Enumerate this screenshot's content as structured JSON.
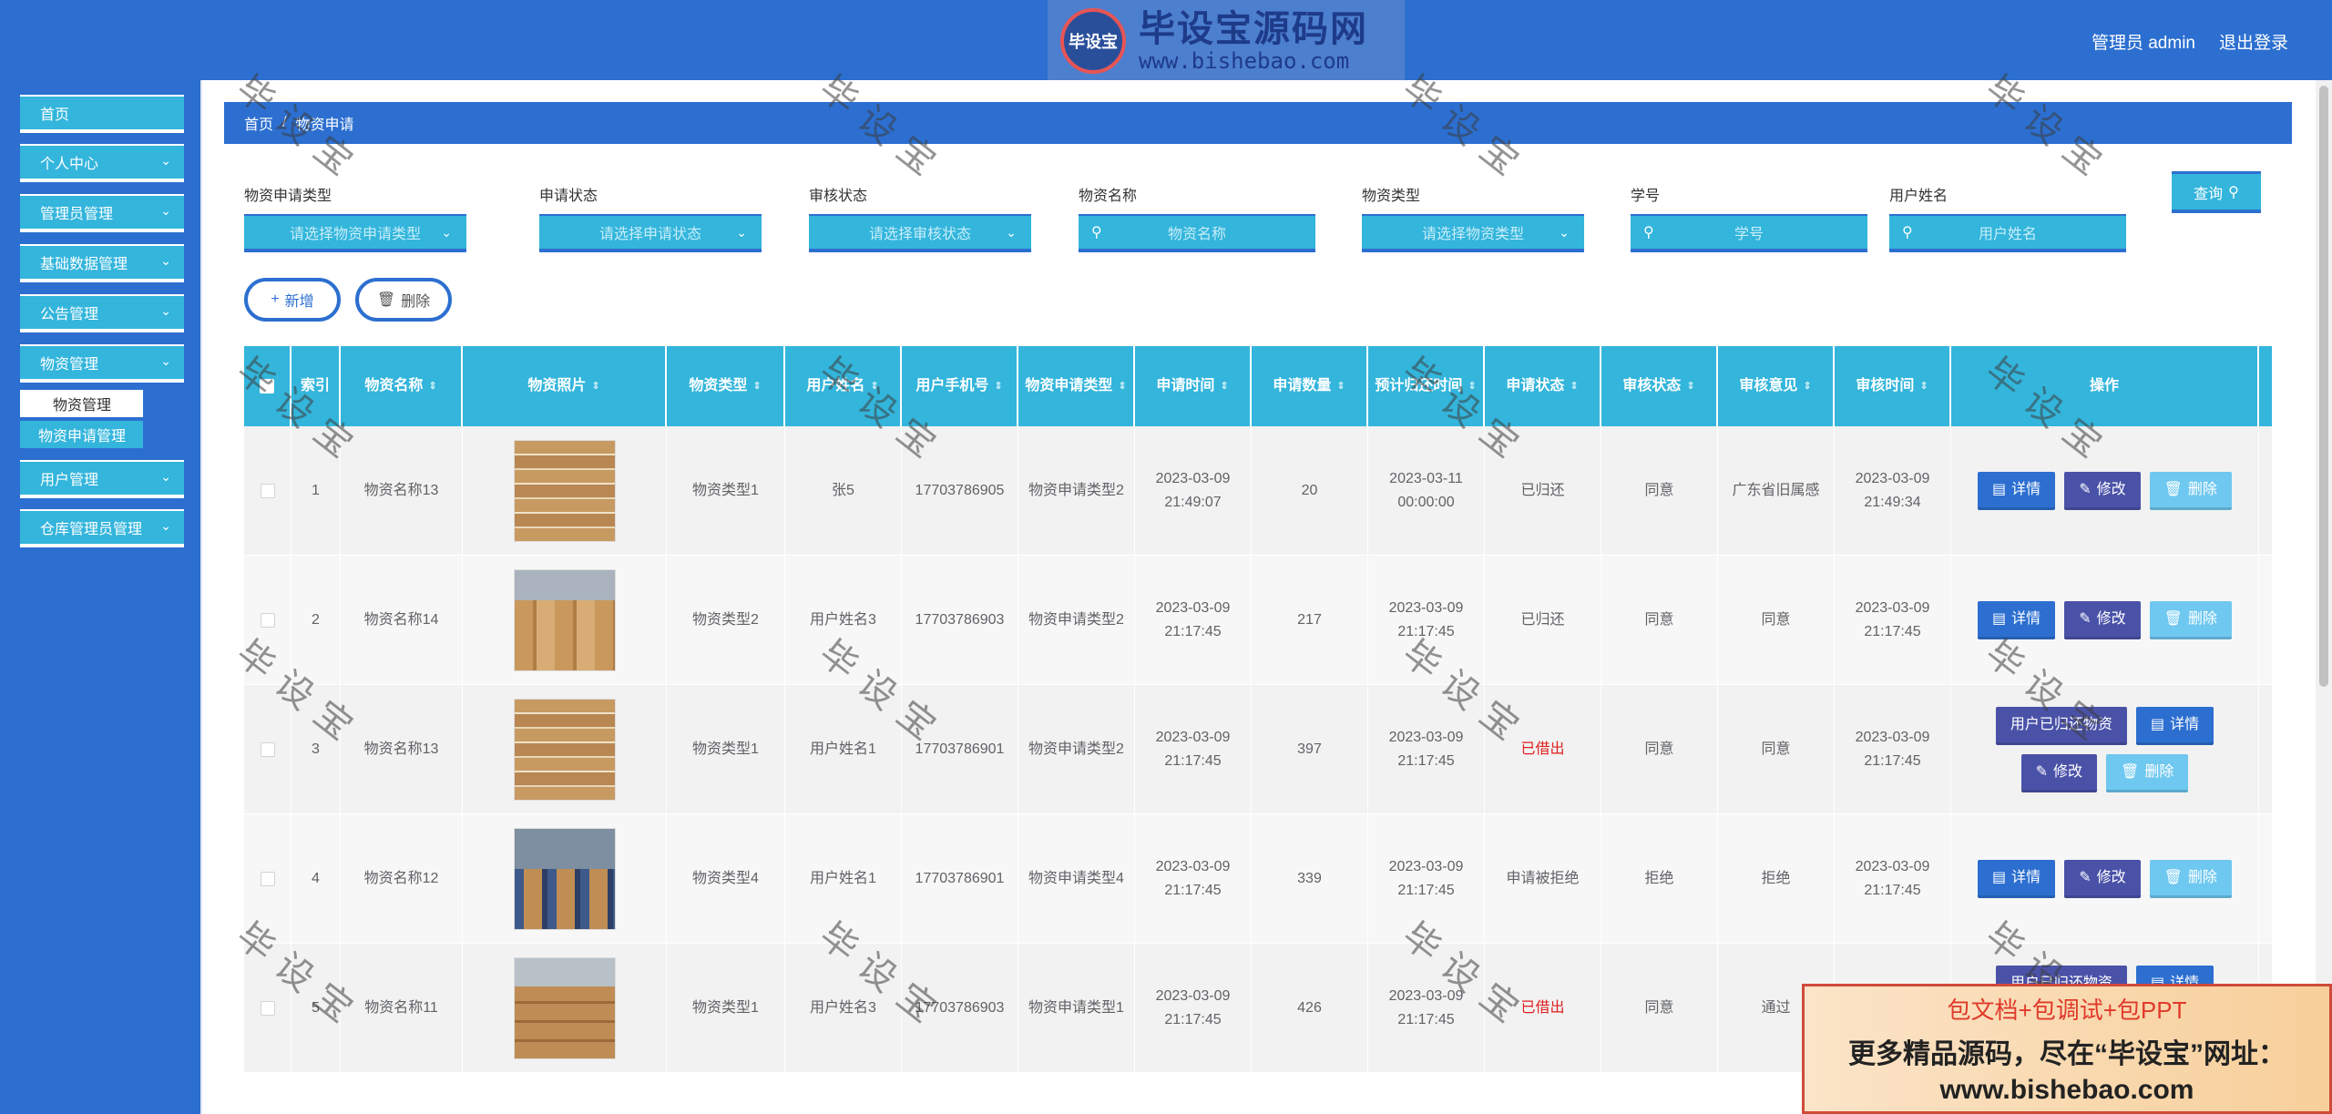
{
  "header": {
    "logo_seal_text": "毕设宝",
    "logo_title": "毕设宝源码网",
    "logo_url": "www.bishebao.com",
    "admin_label": "管理员 admin",
    "logout_label": "退出登录"
  },
  "sidebar": {
    "items": [
      {
        "label": "首页",
        "has_chevron": false
      },
      {
        "label": "个人中心",
        "has_chevron": true
      },
      {
        "label": "管理员管理",
        "has_chevron": true
      },
      {
        "label": "基础数据管理",
        "has_chevron": true
      },
      {
        "label": "公告管理",
        "has_chevron": true
      },
      {
        "label": "物资管理",
        "has_chevron": true
      },
      {
        "label": "用户管理",
        "has_chevron": true
      },
      {
        "label": "仓库管理员管理",
        "has_chevron": true
      }
    ],
    "sub_items": [
      {
        "label": "物资管理"
      },
      {
        "label": "物资申请管理"
      }
    ]
  },
  "breadcrumb": {
    "home": "首页",
    "separator": "/",
    "current": "物资申请"
  },
  "filters": [
    {
      "label": "物资申请类型",
      "placeholder": "请选择物资申请类型",
      "kind": "select"
    },
    {
      "label": "申请状态",
      "placeholder": "请选择申请状态",
      "kind": "select"
    },
    {
      "label": "审核状态",
      "placeholder": "请选择审核状态",
      "kind": "select"
    },
    {
      "label": "物资名称",
      "placeholder": "物资名称",
      "kind": "input"
    },
    {
      "label": "物资类型",
      "placeholder": "请选择物资类型",
      "kind": "select"
    },
    {
      "label": "学号",
      "placeholder": "学号",
      "kind": "input"
    },
    {
      "label": "用户姓名",
      "placeholder": "用户姓名",
      "kind": "input"
    }
  ],
  "buttons": {
    "search": "查询",
    "add": "新增",
    "delete": "删除"
  },
  "table": {
    "columns": [
      "索引",
      "物资名称",
      "物资照片",
      "物资类型",
      "用户姓名",
      "用户手机号",
      "物资申请类型",
      "申请时间",
      "申请数量",
      "预计归还时间",
      "申请状态",
      "审核状态",
      "审核意见",
      "审核时间",
      "操作"
    ],
    "op_labels": {
      "detail": "详情",
      "edit": "修改",
      "delete": "删除",
      "return": "用户已归还物资"
    },
    "rows": [
      {
        "index": "1",
        "name": "物资名称13",
        "type": "物资类型1",
        "user": "张5",
        "phone": "17703786905",
        "apply_type": "物资申请类型2",
        "apply_time": "2023-03-09 21:49:07",
        "qty": "20",
        "return_time": "2023-03-11 00:00:00",
        "status": "已归还",
        "status_red": false,
        "audit": "同意",
        "opinion": "广东省旧属感",
        "audit_time": "2023-03-09 21:49:34",
        "has_return_btn": false
      },
      {
        "index": "2",
        "name": "物资名称14",
        "type": "物资类型2",
        "user": "用户姓名3",
        "phone": "17703786903",
        "apply_type": "物资申请类型2",
        "apply_time": "2023-03-09 21:17:45",
        "qty": "217",
        "return_time": "2023-03-09 21:17:45",
        "status": "已归还",
        "status_red": false,
        "audit": "同意",
        "opinion": "同意",
        "audit_time": "2023-03-09 21:17:45",
        "has_return_btn": false
      },
      {
        "index": "3",
        "name": "物资名称13",
        "type": "物资类型1",
        "user": "用户姓名1",
        "phone": "17703786901",
        "apply_type": "物资申请类型2",
        "apply_time": "2023-03-09 21:17:45",
        "qty": "397",
        "return_time": "2023-03-09 21:17:45",
        "status": "已借出",
        "status_red": true,
        "audit": "同意",
        "opinion": "同意",
        "audit_time": "2023-03-09 21:17:45",
        "has_return_btn": true
      },
      {
        "index": "4",
        "name": "物资名称12",
        "type": "物资类型4",
        "user": "用户姓名1",
        "phone": "17703786901",
        "apply_type": "物资申请类型4",
        "apply_time": "2023-03-09 21:17:45",
        "qty": "339",
        "return_time": "2023-03-09 21:17:45",
        "status": "申请被拒绝",
        "status_red": false,
        "audit": "拒绝",
        "opinion": "拒绝",
        "audit_time": "2023-03-09 21:17:45",
        "has_return_btn": false
      },
      {
        "index": "5",
        "name": "物资名称11",
        "type": "物资类型1",
        "user": "用户姓名3",
        "phone": "17703786903",
        "apply_type": "物资申请类型1",
        "apply_time": "2023-03-09 21:17:45",
        "qty": "426",
        "return_time": "2023-03-09 21:17:45",
        "status": "已借出",
        "status_red": true,
        "audit": "同意",
        "opinion": "通过",
        "audit_time": "",
        "has_return_btn": true
      }
    ]
  },
  "watermark_text": "毕设宝",
  "promo": {
    "line1": "包文档+包调试+包PPT",
    "line2": "更多精品源码，尽在“毕设宝”网址：",
    "line3": "www.bishebao.com"
  }
}
